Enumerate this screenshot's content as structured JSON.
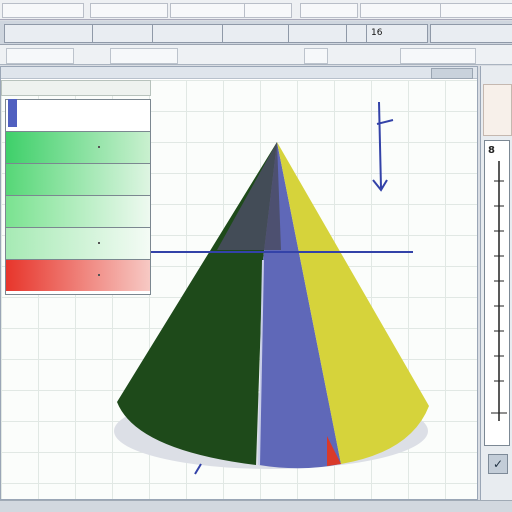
{
  "menubar": {
    "items": [
      "",
      "",
      "",
      "",
      "",
      "",
      ""
    ]
  },
  "toolbar": {
    "buttons": [
      "",
      "",
      "",
      "",
      "",
      "",
      "16",
      ""
    ]
  },
  "window": {
    "title": "",
    "sheet_tab": "",
    "row_labels": [
      "",
      "",
      "",
      "",
      "",
      ""
    ]
  },
  "right_panel": {
    "scale_label": "8"
  },
  "chart": {
    "faces": [
      {
        "name": "",
        "color": "#1e4a1a"
      },
      {
        "name": "",
        "color": "#5f68b8"
      },
      {
        "name": "",
        "color": "#d6d33b"
      },
      {
        "name": "",
        "color": "#d93a2a"
      }
    ]
  },
  "colors": {
    "row_green": "#3fd06a",
    "row_red": "#e7352b",
    "accent_blue": "#3342a8"
  }
}
